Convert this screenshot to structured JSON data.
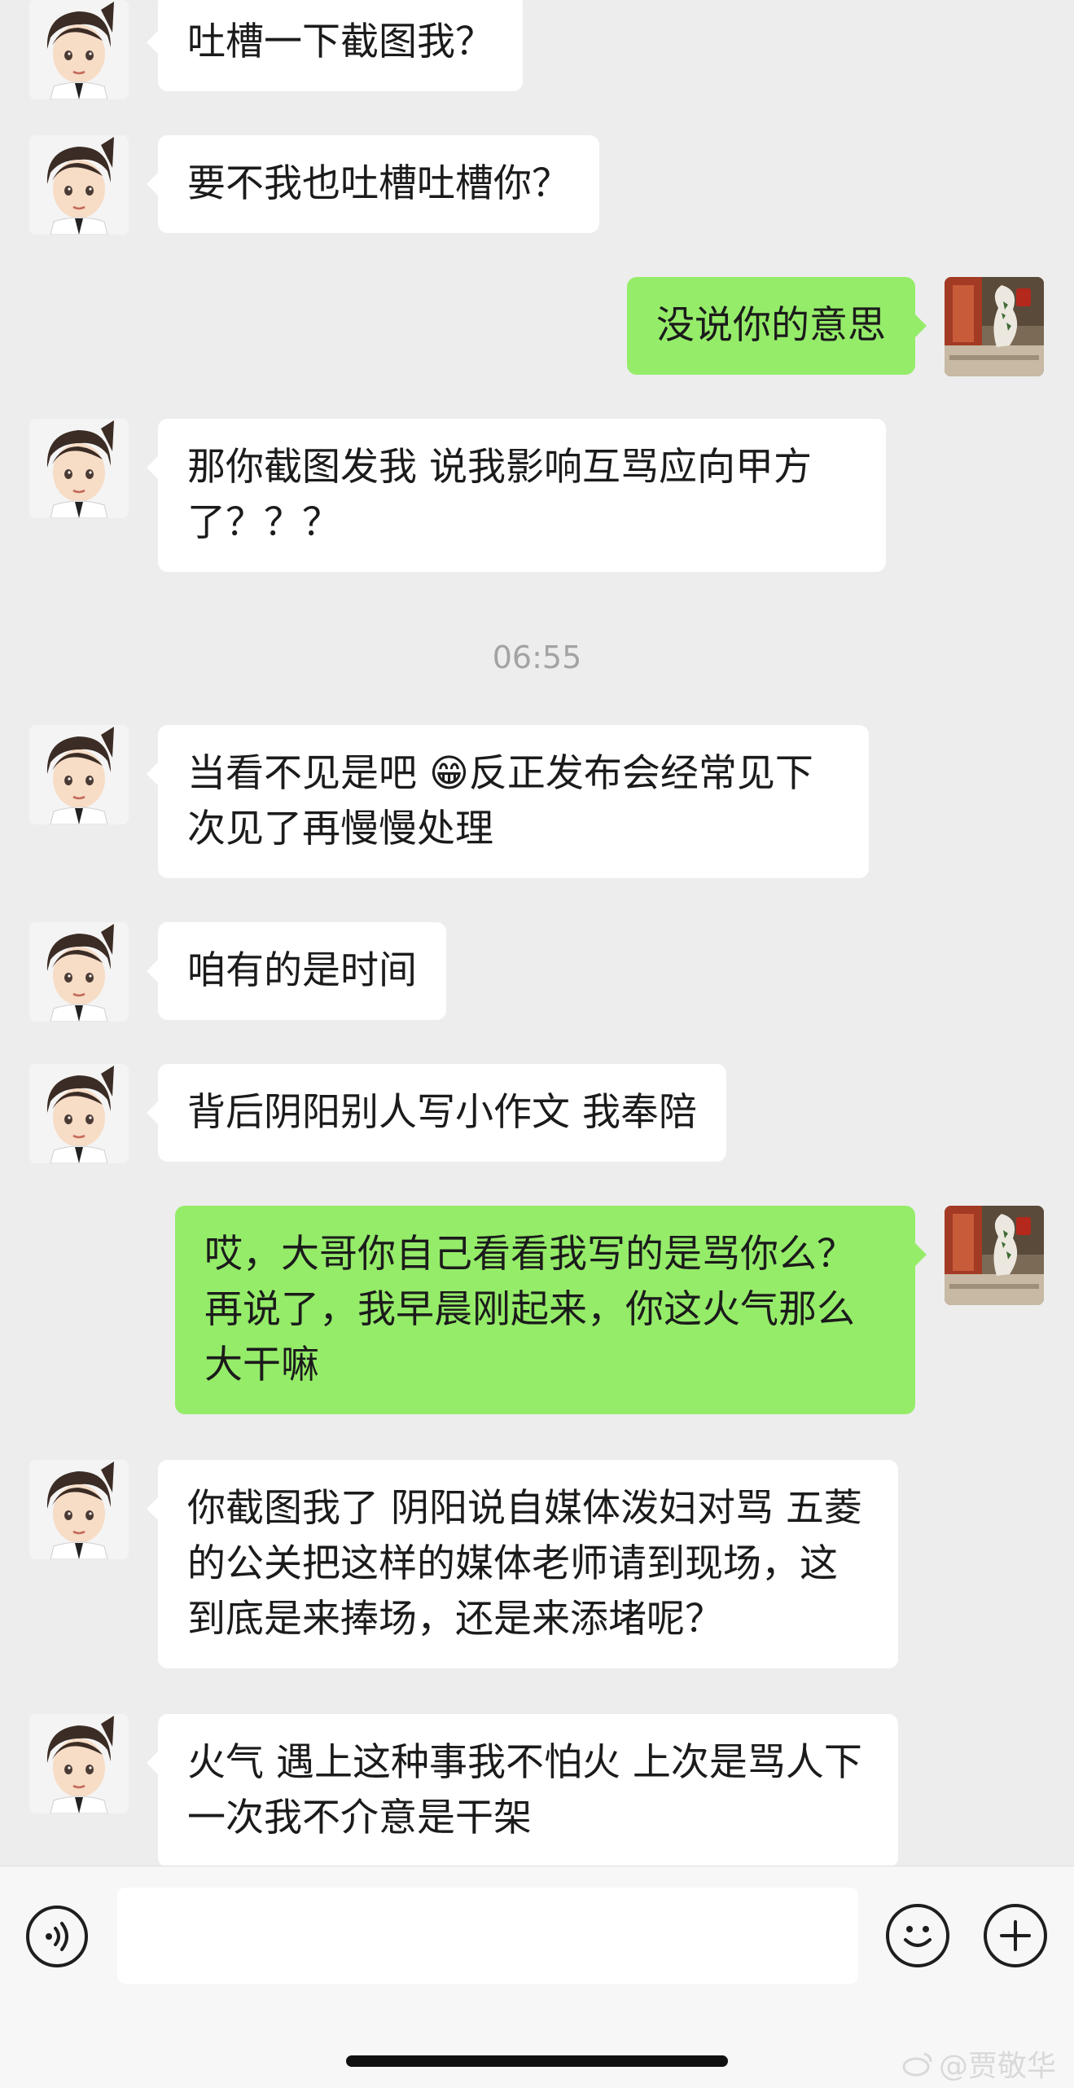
{
  "messages": [
    {
      "side": "in",
      "text": "吐槽一下截图我？"
    },
    {
      "side": "in",
      "text": "要不我也吐槽吐槽你？"
    },
    {
      "side": "out",
      "text": "没说你的意思"
    },
    {
      "side": "in",
      "text": "那你截图发我 说我影响互骂应向甲方了？？？"
    },
    {
      "side": "in",
      "text": "当看不见是吧 😁反正发布会经常见下次见了再慢慢处理"
    },
    {
      "side": "in",
      "text": "咱有的是时间"
    },
    {
      "side": "in",
      "text": "背后阴阳别人写小作文 我奉陪"
    },
    {
      "side": "out",
      "text": "哎，大哥你自己看看我写的是骂你么？再说了，我早晨刚起来，你这火气那么大干嘛"
    },
    {
      "side": "in",
      "text": "你截图我了 阴阳说自媒体泼妇对骂 五菱的公关把这样的媒体老师请到现场，这到底是来捧场，还是来添堵呢？"
    },
    {
      "side": "in",
      "text": "火气 遇上这种事我不怕火 上次是骂人下一次我不介意是干架"
    }
  ],
  "timestamp": "06:55",
  "input": {
    "value": ""
  },
  "icons": {
    "voice": "voice-icon",
    "emoji": "emoji-icon",
    "add": "plus-icon"
  },
  "watermark": "@贾敬华",
  "colors": {
    "background": "#ededed",
    "incoming_bubble": "#ffffff",
    "outgoing_bubble": "#95ec69",
    "timestamp_text": "#a3a3a3"
  }
}
